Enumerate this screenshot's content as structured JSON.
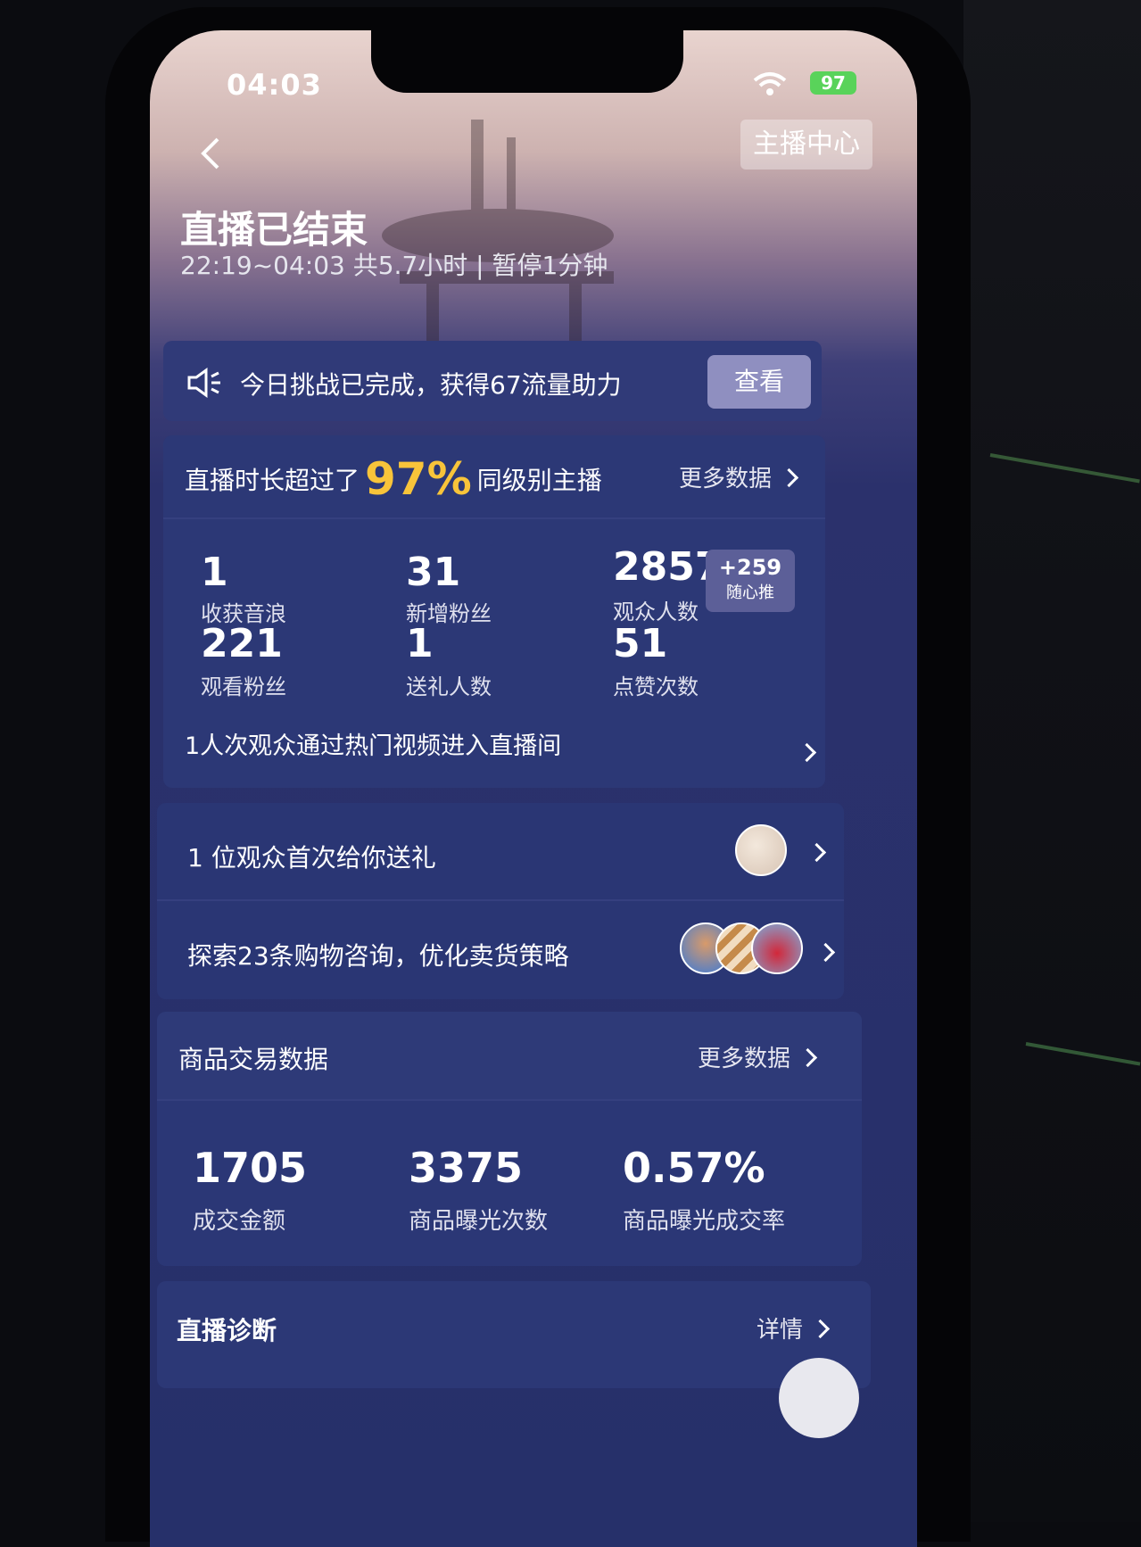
{
  "status_bar": {
    "time": "04:03",
    "battery": "97"
  },
  "header": {
    "anchor_center_label": "主播中心",
    "title": "直播已结束",
    "subtitle": "22:19~04:03 共5.7小时 | 暂停1分钟"
  },
  "challenge": {
    "text": "今日挑战已完成，获得67流量助力",
    "button": "查看"
  },
  "stats": {
    "rank_prefix": "直播时长超过了",
    "rank_percent": "97%",
    "rank_suffix": "同级别主播",
    "more_label": "更多数据",
    "items": [
      {
        "value": "1",
        "label": "收获音浪"
      },
      {
        "value": "31",
        "label": "新增粉丝"
      },
      {
        "value": "2857",
        "label": "观众人数"
      },
      {
        "value": "221",
        "label": "观看粉丝"
      },
      {
        "value": "1",
        "label": "送礼人数"
      },
      {
        "value": "51",
        "label": "点赞次数"
      }
    ],
    "badge": {
      "delta": "+259",
      "label": "随心推"
    },
    "hot_line": "1人次观众通过热门视频进入直播间"
  },
  "gift": {
    "first_gift": "1 位观众首次给你送礼",
    "shopping": "探索23条购物咨询，优化卖货策略"
  },
  "trade": {
    "title": "商品交易数据",
    "more_label": "更多数据",
    "items": [
      {
        "value": "1705",
        "label": "成交金额"
      },
      {
        "value": "3375",
        "label": "商品曝光次数"
      },
      {
        "value": "0.57%",
        "label": "商品曝光成交率"
      }
    ]
  },
  "diagnosis": {
    "title": "直播诊断",
    "detail_label": "详情"
  },
  "icons": [
    "back-arrow-icon",
    "wifi-icon",
    "battery-icon",
    "speaker-icon",
    "chevron-right-icon"
  ]
}
